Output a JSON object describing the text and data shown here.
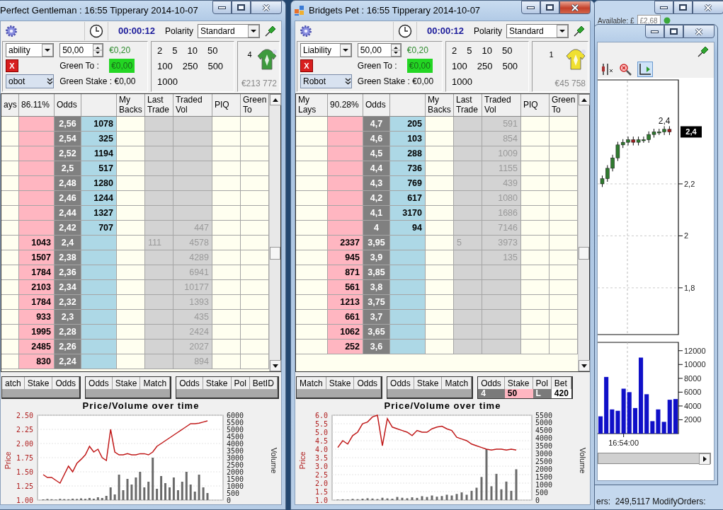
{
  "windows": [
    {
      "title": "Perfect Gentleman : 16:55 Tipperary 2014-10-07",
      "active": false,
      "app_icon": false,
      "timer": "00:00:12",
      "polarity_label": "Polarity",
      "polarity": "Standard",
      "stake_type": "ability",
      "stake": "50,00",
      "stake_value": "€0,20",
      "cancel_label": "X",
      "green_to_label": "Green To :",
      "green_to": "€0,00",
      "robot": "obot",
      "green_stake": "Green Stake : €0,00",
      "stake_buttons": [
        "2",
        "5",
        "10",
        "50",
        "100",
        "250",
        "500",
        "1000"
      ],
      "runner": {
        "number": "4",
        "color": "#3d9a3d",
        "matched": "€213 772"
      },
      "ladder": {
        "columns": [
          {
            "label": "ays"
          },
          {
            "label": "86.11%"
          },
          {
            "label": "Odds"
          },
          {},
          {
            "label": "My Backs"
          },
          {
            "label": "Last Trade"
          },
          {
            "label": "Traded Vol"
          },
          {
            "label": "PIQ"
          },
          {
            "label": "Green To"
          }
        ],
        "rows": [
          {
            "odds": "2,56",
            "back": "1078"
          },
          {
            "odds": "2,54",
            "back": "325"
          },
          {
            "odds": "2,52",
            "back": "1194"
          },
          {
            "odds": "2,5",
            "back": "517"
          },
          {
            "odds": "2,48",
            "back": "1280"
          },
          {
            "odds": "2,46",
            "back": "1244"
          },
          {
            "odds": "2,44",
            "back": "1327"
          },
          {
            "odds": "2,42",
            "back": "707",
            "vol": "447"
          },
          {
            "lay": "1043",
            "odds": "2,4",
            "last": "111",
            "vol": "4578"
          },
          {
            "lay": "1507",
            "odds": "2,38",
            "vol": "4289"
          },
          {
            "lay": "1784",
            "odds": "2,36",
            "vol": "6941"
          },
          {
            "lay": "2103",
            "odds": "2,34",
            "vol": "10177"
          },
          {
            "lay": "1784",
            "odds": "2,32",
            "vol": "1393"
          },
          {
            "lay": "933",
            "odds": "2,3",
            "vol": "435"
          },
          {
            "lay": "1995",
            "odds": "2,28",
            "vol": "2424"
          },
          {
            "lay": "2485",
            "odds": "2,26",
            "vol": "2027"
          },
          {
            "lay": "830",
            "odds": "2,24",
            "vol": "894"
          }
        ]
      },
      "bet_tables": [
        {
          "columns": [
            "atch",
            "Stake",
            "Odds"
          ]
        },
        {
          "columns": [
            "Odds",
            "Stake",
            "Match"
          ]
        },
        {
          "columns": [
            "Odds",
            "Stake",
            "Pol",
            "BetID"
          ]
        }
      ],
      "chart": {
        "title": "Price/Volume over time",
        "chart_data": {
          "type": "line",
          "ylabel": "Price",
          "y2label": "Volume",
          "grid": true,
          "ylim": [
            1.0,
            2.5
          ],
          "y2lim": [
            0,
            6000
          ],
          "yticks": [
            {
              "value": 1.0,
              "label": "1.00"
            },
            {
              "value": 1.25,
              "label": "1.25"
            },
            {
              "value": 1.5,
              "label": "1.50"
            },
            {
              "value": 1.75,
              "label": "1.75"
            },
            {
              "value": 2.0,
              "label": "2.00"
            },
            {
              "value": 2.25,
              "label": "2.25"
            },
            {
              "value": 2.5,
              "label": "2.50"
            }
          ],
          "y2ticks": [
            0,
            500,
            1000,
            1500,
            2000,
            2500,
            3000,
            3500,
            4000,
            4500,
            5000,
            5500,
            6000
          ],
          "series": [
            {
              "type": "bar",
              "axis": "y2",
              "color": "#6a6a6a",
              "values": [
                50,
                80,
                60,
                40,
                90,
                70,
                60,
                100,
                80,
                120,
                90,
                150,
                100,
                200,
                150,
                300,
                900,
                400,
                1800,
                700,
                1500,
                1100,
                1600,
                2000,
                900,
                1300,
                3000,
                800,
                1700,
                1200,
                900,
                1600,
                700,
                1300,
                2000,
                1100,
                600,
                1800,
                900,
                500
              ]
            },
            {
              "color": "#c01818",
              "values": [
                1.45,
                1.4,
                1.4,
                1.35,
                1.3,
                1.45,
                1.6,
                1.5,
                1.65,
                1.72,
                1.8,
                1.95,
                1.85,
                1.9,
                1.75,
                1.7,
                2.25,
                1.85,
                1.8,
                1.8,
                1.82,
                1.8,
                1.8,
                1.82,
                1.82,
                1.8,
                1.85,
                1.95,
                2.0,
                2.05,
                2.1,
                2.15,
                2.2,
                2.25,
                2.3,
                2.35,
                2.35,
                2.36,
                2.38,
                2.4
              ]
            }
          ]
        }
      }
    },
    {
      "title": "Bridgets Pet : 16:55 Tipperary 2014-10-07",
      "active": true,
      "app_icon": true,
      "timer": "00:00:12",
      "polarity_label": "Polarity",
      "polarity": "Standard",
      "stake_type": "Liability",
      "stake": "50,00",
      "stake_value": "€0,20",
      "cancel_label": "X",
      "green_to_label": "Green To :",
      "green_to": "€0,00",
      "robot": "Robot",
      "green_stake": "Green Stake : €0,00",
      "stake_buttons": [
        "2",
        "5",
        "10",
        "50",
        "100",
        "250",
        "500",
        "1000"
      ],
      "runner": {
        "number": "1",
        "color": "#f0e030",
        "matched": "€45 758"
      },
      "ladder": {
        "columns": [
          {
            "label": "My Lays"
          },
          {
            "label": "90.28%"
          },
          {
            "label": "Odds"
          },
          {},
          {
            "label": "My Backs"
          },
          {
            "label": "Last Trade"
          },
          {
            "label": "Traded Vol"
          },
          {
            "label": "PIQ"
          },
          {
            "label": "Green To"
          }
        ],
        "rows": [
          {
            "odds": "4,7",
            "back": "205",
            "vol": "591"
          },
          {
            "odds": "4,6",
            "back": "103",
            "vol": "854"
          },
          {
            "odds": "4,5",
            "back": "288",
            "vol": "1009"
          },
          {
            "odds": "4,4",
            "back": "736",
            "vol": "1155"
          },
          {
            "odds": "4,3",
            "back": "769",
            "vol": "439"
          },
          {
            "odds": "4,2",
            "back": "617",
            "vol": "1080"
          },
          {
            "odds": "4,1",
            "back": "3170",
            "vol": "1686"
          },
          {
            "odds": "4",
            "back": "94",
            "vol": "7146"
          },
          {
            "lay": "2337",
            "odds": "3,95",
            "last": "5",
            "vol": "3973"
          },
          {
            "lay": "945",
            "odds": "3,9",
            "vol": "135"
          },
          {
            "lay": "871",
            "odds": "3,85"
          },
          {
            "lay": "561",
            "odds": "3,8"
          },
          {
            "lay": "1213",
            "odds": "3,75"
          },
          {
            "lay": "661",
            "odds": "3,7"
          },
          {
            "lay": "1062",
            "odds": "3,65"
          },
          {
            "lay": "252",
            "odds": "3,6"
          }
        ]
      },
      "bet_tables": [
        {
          "columns": [
            "Match",
            "Stake",
            "Odds"
          ]
        },
        {
          "columns": [
            "Odds",
            "Stake",
            "Match"
          ]
        },
        {
          "columns": [
            "Odds",
            "Stake",
            "Pol",
            "Bet"
          ],
          "rows": [
            [
              "4",
              "50",
              "L",
              "420"
            ]
          ]
        }
      ],
      "chart": {
        "title": "Price/Volume over time",
        "chart_data": {
          "type": "line",
          "ylabel": "Price",
          "y2label": "Volume",
          "grid": true,
          "ylim": [
            1.0,
            6.0
          ],
          "y2lim": [
            0,
            5500
          ],
          "yticks": [
            {
              "value": 1.0,
              "label": "1.0"
            },
            {
              "value": 1.5,
              "label": "1.5"
            },
            {
              "value": 2.0,
              "label": "2.0"
            },
            {
              "value": 2.5,
              "label": "2.5"
            },
            {
              "value": 3.0,
              "label": "3.0"
            },
            {
              "value": 3.5,
              "label": "3.5"
            },
            {
              "value": 4.0,
              "label": "4.0"
            },
            {
              "value": 4.5,
              "label": "4.5"
            },
            {
              "value": 5.0,
              "label": "5.0"
            },
            {
              "value": 5.5,
              "label": "5.5"
            },
            {
              "value": 6.0,
              "label": "6.0"
            }
          ],
          "y2ticks": [
            0,
            500,
            1000,
            1500,
            2000,
            2500,
            3000,
            3500,
            4000,
            4500,
            5000,
            5500
          ],
          "series": [
            {
              "type": "bar",
              "axis": "y2",
              "color": "#6a6a6a",
              "values": [
                30,
                50,
                40,
                80,
                60,
                90,
                120,
                100,
                70,
                150,
                110,
                90,
                200,
                150,
                120,
                180,
                140,
                250,
                200,
                300,
                220,
                260,
                350,
                300,
                400,
                500,
                350,
                600,
                800,
                1500,
                3300,
                900,
                1700,
                700,
                1200,
                600,
                2000
              ]
            },
            {
              "color": "#c01818",
              "values": [
                4.1,
                4.5,
                4.3,
                4.8,
                5.0,
                5.5,
                5.6,
                5.9,
                6.0,
                4.2,
                5.8,
                5.3,
                5.2,
                5.1,
                5.0,
                4.8,
                5.1,
                5.0,
                5.0,
                5.2,
                5.3,
                5.35,
                5.2,
                5.1,
                4.7,
                4.6,
                4.5,
                4.3,
                4.2,
                4.1,
                4.0,
                3.95,
                4.0,
                4.0,
                3.95,
                4.0,
                3.95
              ]
            }
          ]
        }
      }
    }
  ],
  "back_window": {
    "available_label": "Available: £",
    "available": "£2,68",
    "status": "ers:  249,5117 ModifyOrders:"
  },
  "chart_window": {
    "candle_chart": {
      "price_tag": "2,4",
      "chart_data": {
        "type": "candlestick",
        "ylim": [
          1.62,
          2.6
        ],
        "grid": true,
        "yticks": [
          {
            "value": 2.2,
            "label": "2,2"
          },
          {
            "value": 2.0,
            "label": "2"
          },
          {
            "value": 1.8,
            "label": "1,8"
          }
        ],
        "ohlc": [
          [
            2.2,
            2.232,
            2.188,
            2.22
          ],
          [
            2.22,
            2.272,
            2.208,
            2.26
          ],
          [
            2.26,
            2.312,
            2.248,
            2.3
          ],
          [
            2.3,
            2.362,
            2.288,
            2.35
          ],
          [
            2.35,
            2.372,
            2.338,
            2.36
          ],
          [
            2.36,
            2.382,
            2.348,
            2.37
          ],
          [
            2.37,
            2.382,
            2.348,
            2.36
          ],
          [
            2.36,
            2.382,
            2.348,
            2.37
          ],
          [
            2.37,
            2.382,
            2.358,
            2.37
          ],
          [
            2.37,
            2.402,
            2.358,
            2.39
          ],
          [
            2.39,
            2.412,
            2.378,
            2.4
          ],
          [
            2.4,
            2.412,
            2.388,
            2.4
          ],
          [
            2.4,
            2.422,
            2.388,
            2.41
          ],
          [
            2.41,
            2.422,
            2.388,
            2.4
          ]
        ],
        "annotations": [
          {
            "text": "2,4",
            "y": 2.43
          }
        ]
      }
    },
    "volume_chart": {
      "time_label": "16:54:00",
      "chart_data": {
        "type": "bar",
        "ylim": [
          0,
          13000
        ],
        "yticks": [
          {
            "value": 12000,
            "label": "12000"
          },
          {
            "value": 10000,
            "label": "10000"
          },
          {
            "value": 8000,
            "label": "8000"
          },
          {
            "value": 6000,
            "label": "6000"
          },
          {
            "value": 4000,
            "label": "4000"
          },
          {
            "value": 2000,
            "label": "2000"
          }
        ],
        "series": [
          {
            "color": "#1010c8",
            "values": [
              2500,
              8200,
              3500,
              3300,
              6500,
              6000,
              3700,
              11000,
              5700,
              1800,
              3500,
              1700,
              4900,
              5000
            ]
          }
        ]
      }
    }
  }
}
